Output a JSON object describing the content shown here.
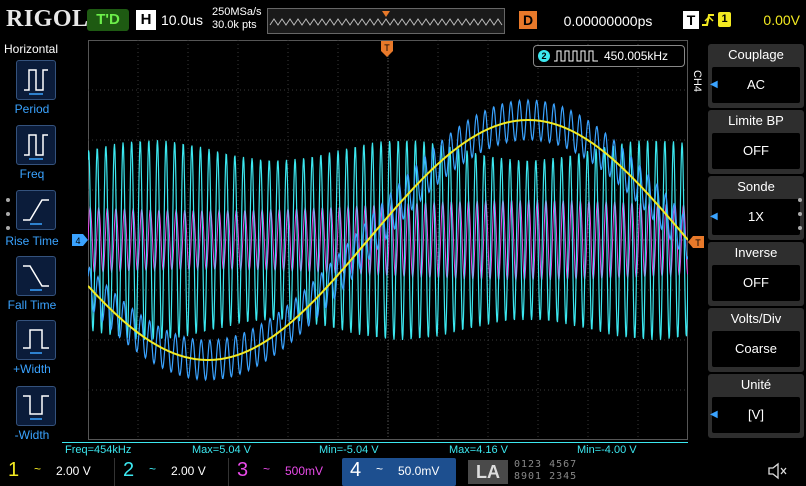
{
  "header": {
    "logo": "RIGOL",
    "run_status": "T'D",
    "timebase_key": "H",
    "timebase": "10.0us",
    "sample_rate": "250MSa/s",
    "memory_depth": "30.0k pts",
    "delay_key": "D",
    "delay": "0.00000000ps",
    "trigger_key": "T",
    "trigger_source": "1",
    "trigger_level": "0.00V"
  },
  "horizontal_menu": {
    "title": "Horizontal",
    "items": [
      {
        "label": "Period"
      },
      {
        "label": "Freq"
      },
      {
        "label": "Rise Time"
      },
      {
        "label": "Fall Time"
      },
      {
        "label": "+Width"
      },
      {
        "label": "-Width"
      }
    ]
  },
  "counter": {
    "channel": "2",
    "value": "450.005kHz"
  },
  "markers": {
    "ch4": "4",
    "trigger": "T"
  },
  "channel_menu": {
    "channel_label": "CH4",
    "items": [
      {
        "title": "Couplage",
        "value": "AC"
      },
      {
        "title": "Limite BP",
        "value": "OFF"
      },
      {
        "title": "Sonde",
        "value": "1X"
      },
      {
        "title": "Inverse",
        "value": "OFF"
      },
      {
        "title": "Volts/Div",
        "value": "Coarse"
      },
      {
        "title": "Unité",
        "value": "[V]"
      }
    ]
  },
  "measurements": [
    {
      "text": "Freq=454kHz",
      "color": "#3ce8f0"
    },
    {
      "text": "Max=5.04 V",
      "color": "#3ce8f0"
    },
    {
      "text": "Min=-5.04 V",
      "color": "#3ce8f0"
    },
    {
      "text": "Max=4.16 V",
      "color": "#3ce8f0"
    },
    {
      "text": "Min=-4.00 V",
      "color": "#3ce8f0"
    }
  ],
  "channels": [
    {
      "number": "1",
      "coupling": "~",
      "scale": "2.00 V",
      "color": "#f3ea21"
    },
    {
      "number": "2",
      "coupling": "~",
      "scale": "2.00 V",
      "color": "#3ce8f0"
    },
    {
      "number": "3",
      "coupling": "~",
      "scale": "500mV",
      "color": "#e84ae8"
    },
    {
      "number": "4",
      "coupling": "~",
      "scale": "50.0mV",
      "color": "#3aa3ff"
    }
  ],
  "la": {
    "label": "LA",
    "bits_top": "0123 4567",
    "bits_bottom": "8901 2345"
  },
  "colors": {
    "ch1": "#f3ea21",
    "ch2": "#3ce8f0",
    "ch3": "#e84ae8",
    "ch4": "#3aa3ff",
    "trigger_marker": "#e8792a"
  }
}
